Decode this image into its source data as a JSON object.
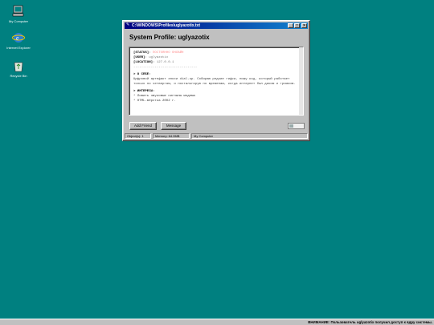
{
  "desktop": {
    "background": "#008080",
    "icons": [
      {
        "label": "My Computer",
        "icon": "computer-icon"
      },
      {
        "label": "Internet Explorer",
        "icon": "ie-icon"
      },
      {
        "label": "Recycle Bin",
        "icon": "recycle-bin-icon"
      }
    ]
  },
  "window": {
    "title": "C:\\WINDOWS\\Profiles\\uglyazotix.txt",
    "heading": "System Profile: uglyazotix",
    "title_buttons": {
      "minimize": "_",
      "maximize": "□",
      "close": "×"
    },
    "profile": {
      "status_key": "[STATUS]",
      "status_value": "ПОСТОЯННО ОНЛАЙН",
      "user_key": "[USER]",
      "user_value": "uglyazotix",
      "location_key": "[LOCATION]",
      "location_value": "127.0.0.1",
      "divider": "---------------------------------",
      "about_heading": "> О СЕБЕ:",
      "about_text": "Цифровой артефакт эпохи dial-up. Собираю редкие гифки, пишу код, который работает только по четвергам, и ностальгирую по временам, когда интернет был диким и громким.",
      "interests_heading": "> ИНТЕРЕСЫ:",
      "interests": [
        "* Ловить звуковые сигналы модема",
        "* HTML-вёрстка 2002 г."
      ]
    },
    "buttons": {
      "add_friend": "Add Friend",
      "message": "Message"
    },
    "status_bar": {
      "objects": "Object(s): 1",
      "memory": "Memory: 64.0MB",
      "location": "My Computer"
    }
  },
  "taskbar": {
    "notice": "ВНИМАНИЕ: Пользователь uglyazotix получил доступ к ядру системы."
  }
}
